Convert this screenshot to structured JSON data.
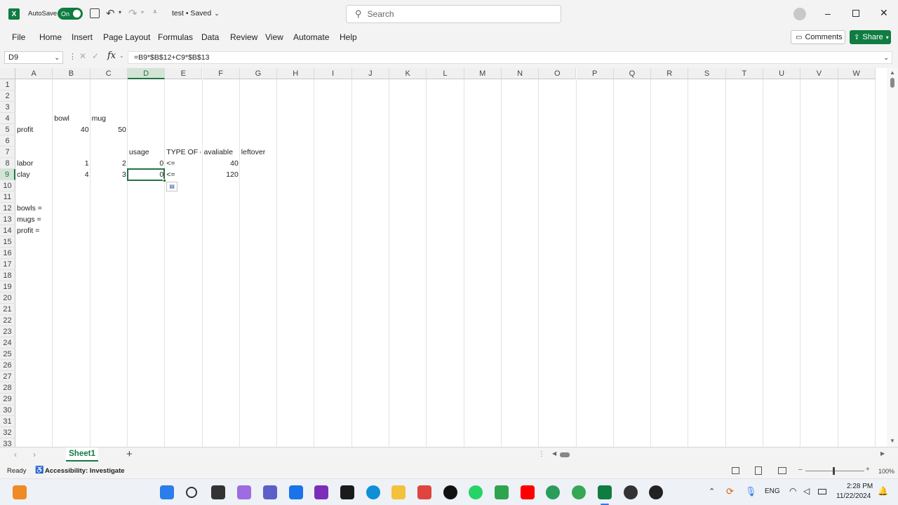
{
  "titlebar": {
    "autosave_label": "AutoSave",
    "autosave_state": "On",
    "doc_title": "test • Saved",
    "search_placeholder": "Search"
  },
  "menu": [
    "File",
    "Home",
    "Insert",
    "Page Layout",
    "Formulas",
    "Data",
    "Review",
    "View",
    "Automate",
    "Help"
  ],
  "actions": {
    "comments": "Comments",
    "share": "Share"
  },
  "formula_bar": {
    "name_box": "D9",
    "fx": "fx",
    "formula": "=B9*$B$12+C9*$B$13"
  },
  "columns": [
    "A",
    "B",
    "C",
    "D",
    "E",
    "F",
    "G",
    "H",
    "I",
    "J",
    "K",
    "L",
    "M",
    "N",
    "O",
    "P",
    "Q",
    "R",
    "S",
    "T",
    "U",
    "V",
    "W"
  ],
  "rows": [
    "1",
    "2",
    "3",
    "4",
    "5",
    "6",
    "7",
    "8",
    "9",
    "10",
    "11",
    "12",
    "13",
    "14",
    "15",
    "16",
    "17",
    "18",
    "19",
    "20",
    "21",
    "22",
    "23",
    "24",
    "25",
    "26",
    "27",
    "28",
    "29",
    "30",
    "31",
    "32",
    "33"
  ],
  "cells": {
    "B4": "bowl",
    "C4": "mug",
    "A5": "profit",
    "B5": "40",
    "C5": "50",
    "D7": "usage",
    "E7": "TYPE OF cc",
    "F7": "avaliable",
    "G7": "leftover",
    "A8": "labor",
    "B8": "1",
    "C8": "2",
    "D8": "0",
    "E8": "<=",
    "F8": "40",
    "A9": "clay",
    "B9": "4",
    "C9": "3",
    "D9": "0",
    "E9": "<=",
    "F9": "120",
    "A12": "bowls =",
    "A13": "mugs =",
    "A14": "profit ="
  },
  "sheet": {
    "tab": "Sheet1",
    "add": "+"
  },
  "status": {
    "ready": "Ready",
    "accessibility": "Accessibility: Investigate",
    "zoom": "100%"
  },
  "taskbar": {
    "time": "2:28 PM",
    "date": "11/22/2024",
    "lang": "ENG"
  },
  "colors": {
    "excel_green": "#107c41",
    "selection": "#217346",
    "title_bg": "#f3f3f3"
  }
}
